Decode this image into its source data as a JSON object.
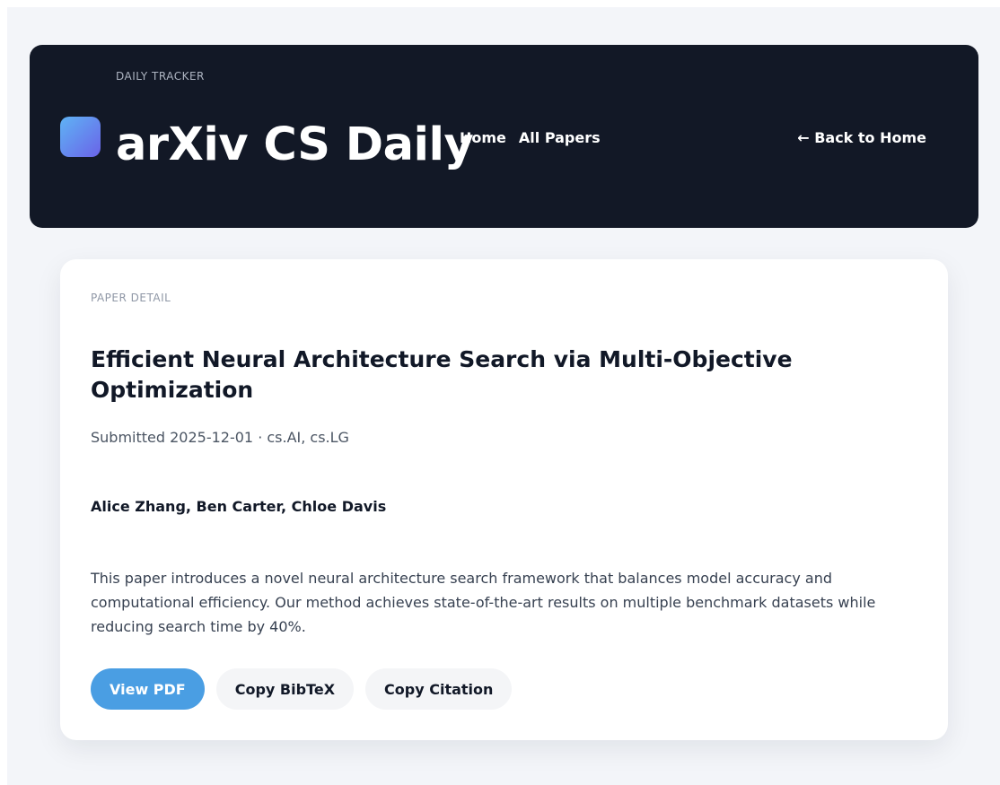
{
  "header": {
    "tracker_label": "DAILY TRACKER",
    "title": "arXiv CS Daily",
    "nav": [
      "Home",
      "All Papers"
    ],
    "back_link": "← Back to Home"
  },
  "paper": {
    "section_label": "PAPER DETAIL",
    "title": "Efficient Neural Architecture Search via Multi-Objective Optimization",
    "meta": "Submitted 2025-12-01 · cs.AI, cs.LG",
    "authors": "Alice Zhang, Ben Carter, Chloe Davis",
    "abstract": "This paper introduces a novel neural architecture search framework that balances model accuracy and computational efficiency. Our method achieves state-of-the-art results on multiple benchmark datasets while reducing search time by 40%."
  },
  "actions": {
    "view_pdf": "View PDF",
    "copy_bibtex": "Copy BibTeX",
    "copy_citation": "Copy Citation"
  },
  "colors": {
    "header_bg": "#121826",
    "page_bg": "#f3f5f9",
    "primary_button": "#4a9ee3",
    "secondary_button": "#f4f5f7",
    "logo_gradient_start": "#5fb3f5",
    "logo_gradient_end": "#6a63e8"
  }
}
